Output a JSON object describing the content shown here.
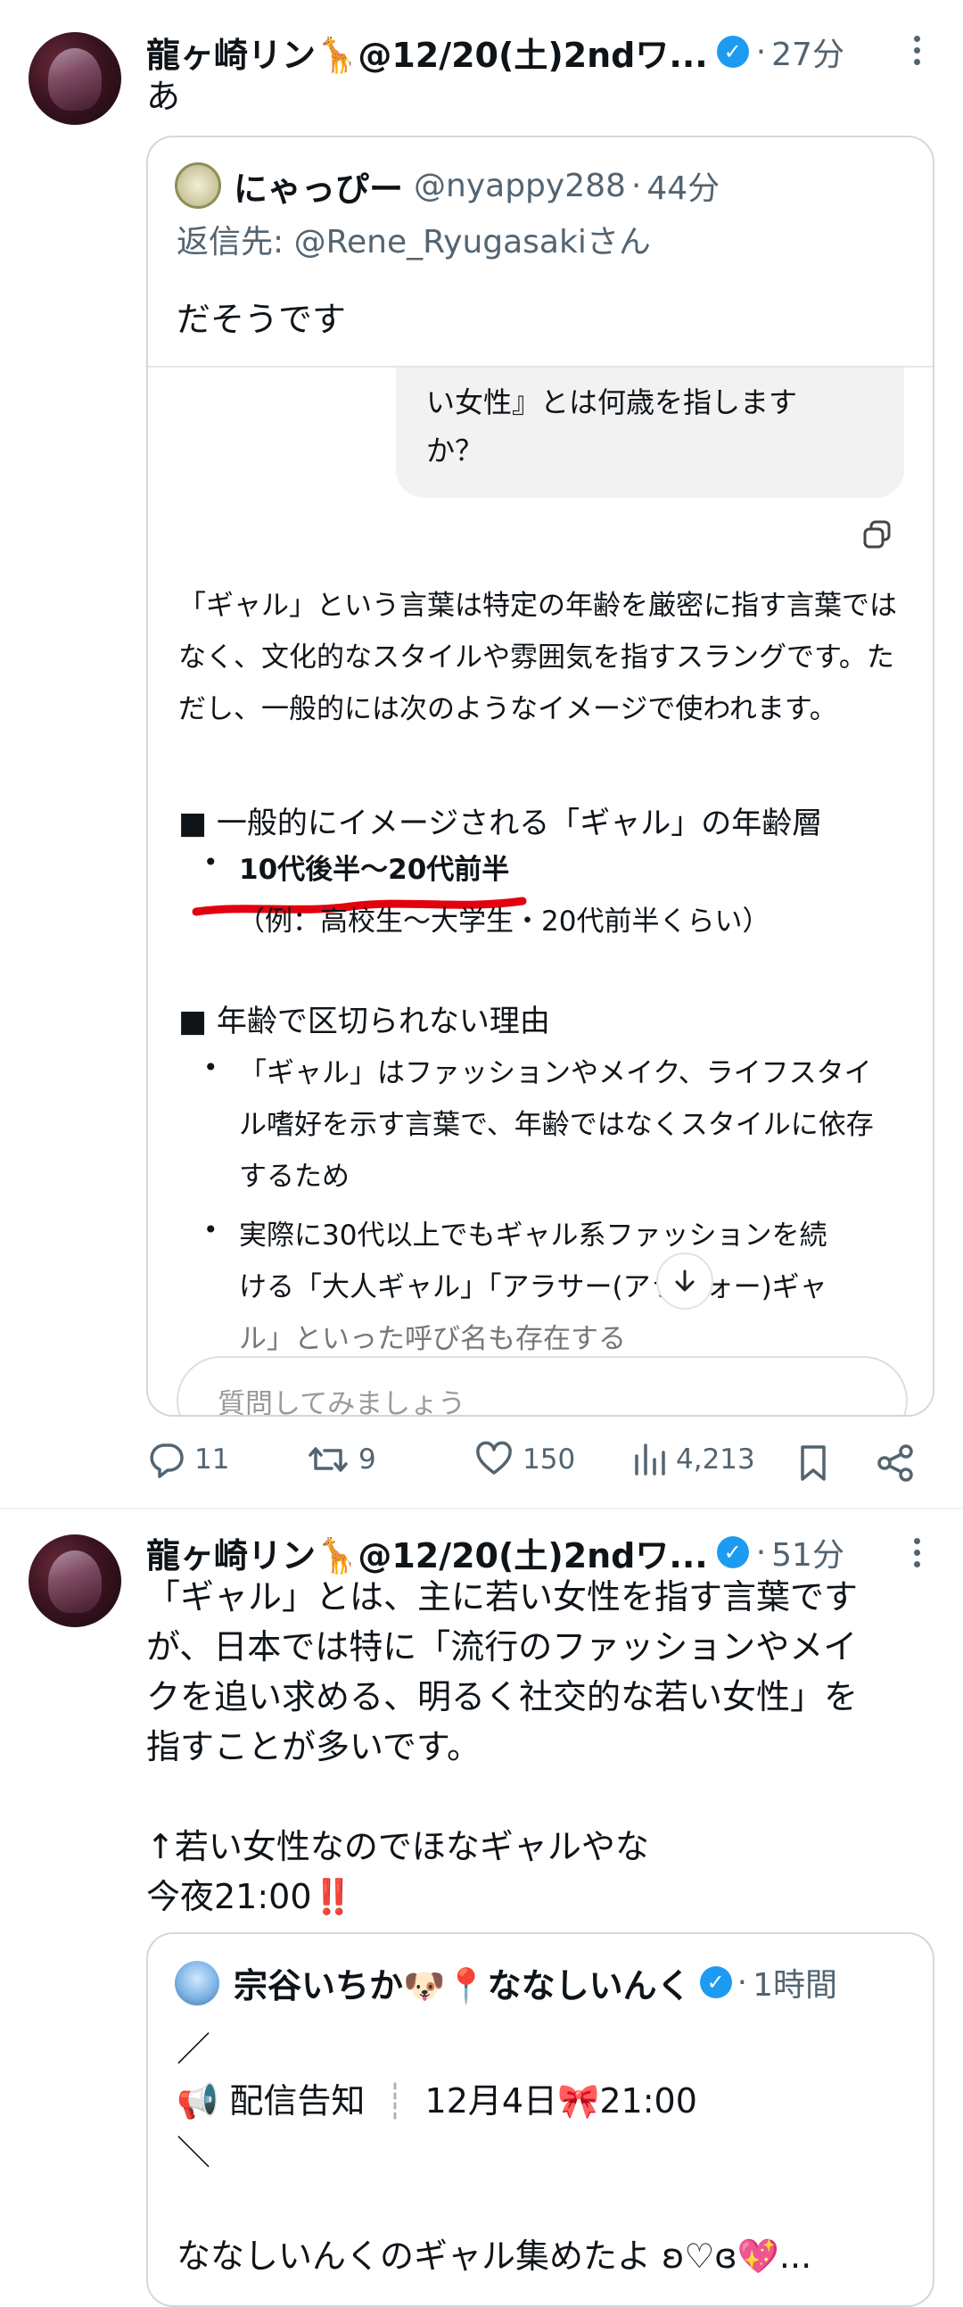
{
  "tweet1": {
    "author": "龍ヶ崎リン🦒@12/20(土)2ndワ...",
    "time": "27分",
    "text": "あ",
    "quote": {
      "author": "にゃっぴー",
      "handle": "@nyappy288",
      "time": "44分",
      "reply_prefix": "返信先: ",
      "reply_to": "@Rene_Ryugasakiさん",
      "text": "だそうです",
      "screenshot": {
        "bubble_line1": "い女性』とは何歳を指します",
        "bubble_line2": "か？",
        "para1": "「ギャル」という言葉は特定の年齢を厳密に指す言葉ではなく、文化的なスタイルや雰囲気を指すスラングです。ただし、一般的には次のようなイメージで使われます。",
        "heading1": "■ 一般的にイメージされる「ギャル」の年齢層",
        "bullet1": "10代後半〜20代前半",
        "bullet1_sub": "（例：高校生〜大学生・20代前半くらい）",
        "heading2": "■ 年齢で区切られない理由",
        "bullet2": "「ギャル」はファッションやメイク、ライフスタイル嗜好を示す言葉で、年齢ではなくスタイルに依存するため",
        "bullet3a": "実際に30代以上でもギャル系ファッションを続",
        "bullet3b": "ける「大人ギャル」「アラサー(アラフォー)ギャ",
        "bullet3c": "ル」といった呼び名も存在する",
        "input_placeholder": "質問してみましょう"
      }
    },
    "stats": {
      "replies": "11",
      "retweets": "9",
      "likes": "150",
      "views": "4,213"
    }
  },
  "tweet2": {
    "author": "龍ヶ崎リン🦒@12/20(土)2ndワ...",
    "time": "51分",
    "text_lines": [
      "「ギャル」とは、主に若い女性を指す言葉です",
      "が、日本では特に「流行のファッションやメイ",
      "クを追い求める、明るく社交的な若い女性」を",
      "指すことが多いです。",
      "",
      "↑若い女性なのでほなギャルやな",
      "今夜21:00‼️"
    ],
    "quote": {
      "author": "宗谷いちか🐶📍ななしいんく",
      "time": "1時間",
      "line1": "／",
      "line2_icon": "📢",
      "line2_a": "配信告知",
      "line2_b": "12月4日🎀21:00",
      "line3": "＼",
      "line4": "ななしいんくのギャル集めたよ ʚ♡ɞ💖..."
    }
  },
  "colors": {
    "accent": "#1d9bf0",
    "gray": "#536471",
    "underline": "#e3000f"
  }
}
